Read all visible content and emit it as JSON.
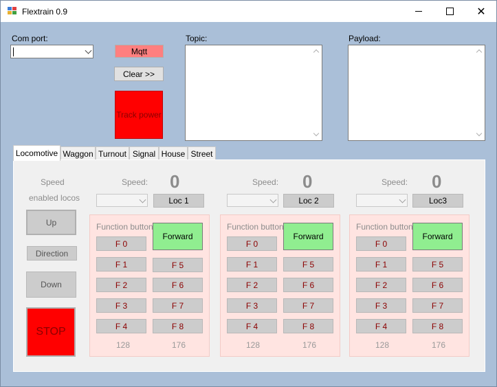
{
  "window": {
    "title": "Flextrain 0.9"
  },
  "com": {
    "label": "Com port:",
    "value": ""
  },
  "mqtt": {
    "label": "Mqtt",
    "color": "#ff7f7f"
  },
  "clear": {
    "label": "Clear >>"
  },
  "track_power": {
    "label": "Track power",
    "color": "#ff0000"
  },
  "topic": {
    "label": "Topic:"
  },
  "payload": {
    "label": "Payload:"
  },
  "tabs": [
    {
      "label": "Locomotive",
      "active": true
    },
    {
      "label": "Waggon"
    },
    {
      "label": "Turnout"
    },
    {
      "label": "Signal"
    },
    {
      "label": "House"
    },
    {
      "label": "Street"
    }
  ],
  "side": {
    "speed_label": "Speed",
    "enabled_locos_label": "enabled locos",
    "up": "Up",
    "direction": "Direction",
    "down": "Down",
    "stop": "STOP",
    "stop_color": "#ff0000"
  },
  "locos": [
    {
      "speed_label": "Speed:",
      "speed_value": "0",
      "button": "Loc 1",
      "function_label": "Function button",
      "forward": "Forward",
      "fn_left": [
        "F 0",
        "F 1",
        "F 2",
        "F 3",
        "F 4"
      ],
      "fn_right": [
        "F 5",
        "F 6",
        "F 7",
        "F 8"
      ],
      "num_left": "128",
      "num_right": "176"
    },
    {
      "speed_label": "Speed:",
      "speed_value": "0",
      "button": "Loc 2",
      "function_label": "Function button",
      "forward": "Forward",
      "fn_left": [
        "F 0",
        "F 1",
        "F 2",
        "F 3",
        "F 4"
      ],
      "fn_right": [
        "F 5",
        "F 6",
        "F 7",
        "F 8"
      ],
      "num_left": "128",
      "num_right": "176"
    },
    {
      "speed_label": "Speed:",
      "speed_value": "0",
      "button": "Loc3",
      "function_label": "Function button",
      "forward": "Forward",
      "fn_left": [
        "F 0",
        "F 1",
        "F 2",
        "F 3",
        "F 4"
      ],
      "fn_right": [
        "F 5",
        "F 6",
        "F 7",
        "F 8"
      ],
      "num_left": "128",
      "num_right": "176"
    }
  ],
  "colors": {
    "forward": "#90ee90",
    "panel": "#ffe4e1",
    "form_bg": "#aabfd8"
  }
}
